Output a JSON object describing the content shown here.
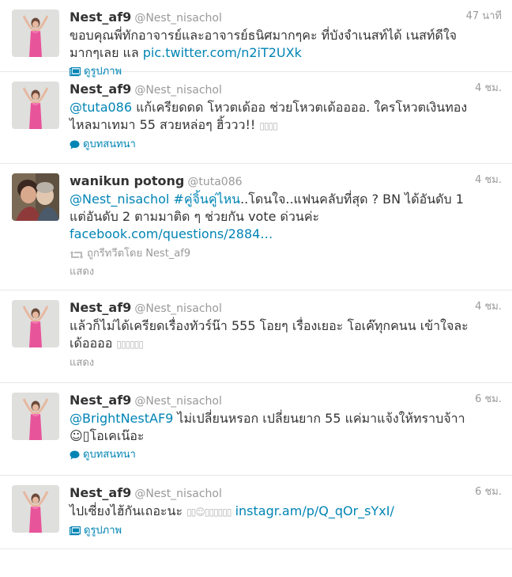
{
  "tweets": [
    {
      "fullname": "Nest_af9",
      "username": "@Nest_nisachol",
      "time": "47 นาที",
      "text_before": "ขอบคุณพี่ทักอาจารย์และอาจารย์ธนิศมากๆคะ ที่บังจำเนสท์ได้ เนสท์ดีใจมากๆเลย แล ",
      "link": "pic.twitter.com/n2iT2UXk",
      "action": "ดูรูปภาพ"
    },
    {
      "fullname": "Nest_af9",
      "username": "@Nest_nisachol",
      "time": "4 ชม.",
      "mention": "@tuta086",
      "text_after": " แก้เครียดดด โหวตเด้ออ ช่วยโหวตเด้ออออ. ใครโหวตเงินทองไหลมาเทมา 55 สวยหล่อๆ ฮิ้ววว!! ",
      "boxes": "▯▯▯▯",
      "action": "ดูบทสนทนา"
    },
    {
      "fullname": "wanikun potong",
      "username": "@tuta086",
      "time": "4 ชม.",
      "mention": "@Nest_nisachol",
      "hashtag": "#คู่จิ้นคู่ไหน",
      "text_middle": "..โดนใจ..แฟนคลับที่สุด ? BN ได้อันดับ 1 แต่อันดับ 2 ตามมาติด ๆ ช่วยกัน vote ด่วนค่ะ ",
      "link": "facebook.com/questions/2884…",
      "retweet": "ถูกรีทวีตโดย Nest_af9",
      "action": "แสดง"
    },
    {
      "fullname": "Nest_af9",
      "username": "@Nest_nisachol",
      "time": "4 ชม.",
      "text_before": "แล้วก็ไม่ได้เครียดเรื่องทัวร์น๊า 555 โอยๆ เรื่องเยอะ โอเค๊ทุกคนน เข้าใจละเด้ออออ ",
      "boxes": "▯▯▯▯▯▯",
      "action": "แสดง"
    },
    {
      "fullname": "Nest_af9",
      "username": "@Nest_nisachol",
      "time": "6 ชม.",
      "mention": "@BrightNestAF9",
      "text_after": " ไม่เปลี่ยนหรอก เปลี่ยนยาก 55 แค่มาแจ้งให้ทราบจ้าา ",
      "text_line2": "☺▯โอเคเน๊อะ",
      "action": "ดูบทสนทนา"
    },
    {
      "fullname": "Nest_af9",
      "username": "@Nest_nisachol",
      "time": "6 ชม.",
      "text_before": "ไปเซี่ยงไฮ้กันเถอะนะ ",
      "boxes": "▯▯☺▯▯▯▯▯▯",
      "link": "instagr.am/p/Q_qOr_sYxI/",
      "action": "ดูรูปภาพ"
    }
  ]
}
